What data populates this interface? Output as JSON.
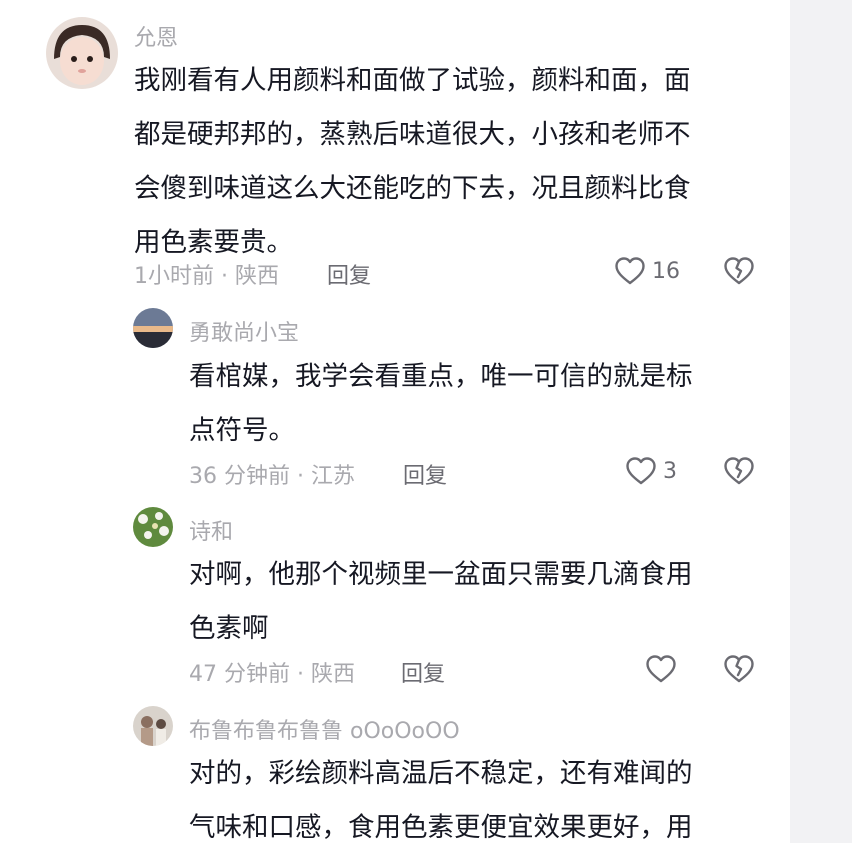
{
  "comments": [
    {
      "user": "允恩",
      "text": "我刚看有人用颜料和面做了试验，颜料和面，面\n都是硬邦邦的，蒸熟后味道很大，小孩和老师不\n会傻到味道这么大还能吃的下去，况且颜料比食\n用色素要贵。",
      "meta": "1小时前 · 陕西",
      "reply": "回复",
      "likes": "16"
    },
    {
      "user": "勇敢尚小宝",
      "text": "看棺媒，我学会看重点，唯一可信的就是标\n点符号。",
      "meta": "36 分钟前 · 江苏",
      "reply": "回复",
      "likes": "3"
    },
    {
      "user": "诗和",
      "text": "对啊，他那个视频里一盆面只需要几滴食用\n色素啊",
      "meta": "47 分钟前 · 陕西",
      "reply": "回复",
      "likes": ""
    },
    {
      "user": "布鲁布鲁布鲁鲁 oOoOoOO",
      "text": "对的，彩绘颜料高温后不稳定，还有难闻的\n气味和口感，食用色素更便宜效果更好，用",
      "meta": "",
      "reply": "",
      "likes": ""
    }
  ],
  "colors": {
    "text": "#161823",
    "secondary": "#a9a9ae",
    "icon": "#6b6b72"
  }
}
